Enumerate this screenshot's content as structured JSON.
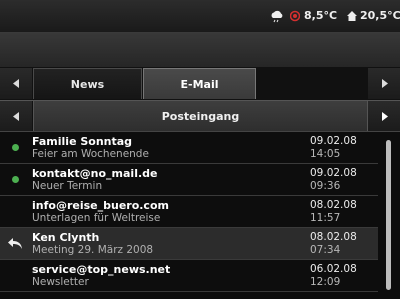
{
  "status": {
    "weather_temp": "8,5°C",
    "home_temp": "20,5°C"
  },
  "tabs": [
    {
      "label": "News",
      "active": false
    },
    {
      "label": "E-Mail",
      "active": true
    }
  ],
  "folder": {
    "label": "Posteingang"
  },
  "emails": [
    {
      "sender": "Familie Sonntag",
      "subject": "Feier am Wochenende",
      "date": "09.02.08",
      "time": "14:05",
      "unread": true,
      "replied": false,
      "highlighted": false
    },
    {
      "sender": "kontakt@no_mail.de",
      "subject": "Neuer Termin",
      "date": "09.02.08",
      "time": "09:36",
      "unread": true,
      "replied": false,
      "highlighted": false
    },
    {
      "sender": "info@reise_buero.com",
      "subject": "Unterlagen für Weltreise",
      "date": "08.02.08",
      "time": "11:57",
      "unread": false,
      "replied": false,
      "highlighted": false
    },
    {
      "sender": "Ken Clynth",
      "subject": "Meeting 29. März 2008",
      "date": "08.02.08",
      "time": "07:34",
      "unread": false,
      "replied": true,
      "highlighted": true
    },
    {
      "sender": "service@top_news.net",
      "subject": "Newsletter",
      "date": "06.02.08",
      "time": "12:09",
      "unread": false,
      "replied": false,
      "highlighted": false
    }
  ],
  "colors": {
    "unread_dot": "#4caf50",
    "thermometer": "#d32f2f"
  },
  "icons": [
    "weather-cloud-icon",
    "thermometer-icon",
    "home-icon",
    "arrow-left-icon",
    "arrow-right-icon",
    "reply-icon"
  ]
}
